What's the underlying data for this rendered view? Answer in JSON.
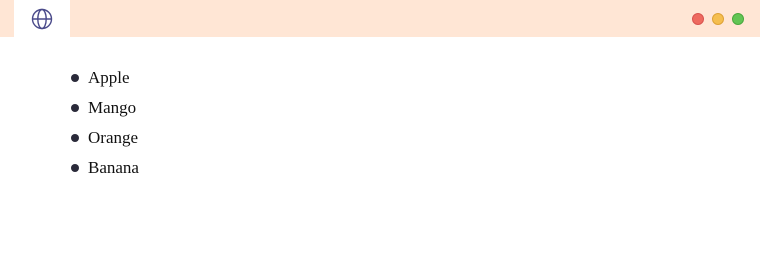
{
  "window": {
    "tab_icon": "globe-icon",
    "controls": [
      "close",
      "minimize",
      "maximize"
    ],
    "colors": {
      "titlebar": "#ffe6d5",
      "close": "#ee6a5f",
      "minimize": "#f5be4f",
      "maximize": "#62c554",
      "icon": "#4a4a8a"
    }
  },
  "list": {
    "items": [
      {
        "label": "Apple"
      },
      {
        "label": "Mango"
      },
      {
        "label": "Orange"
      },
      {
        "label": "Banana"
      }
    ]
  }
}
